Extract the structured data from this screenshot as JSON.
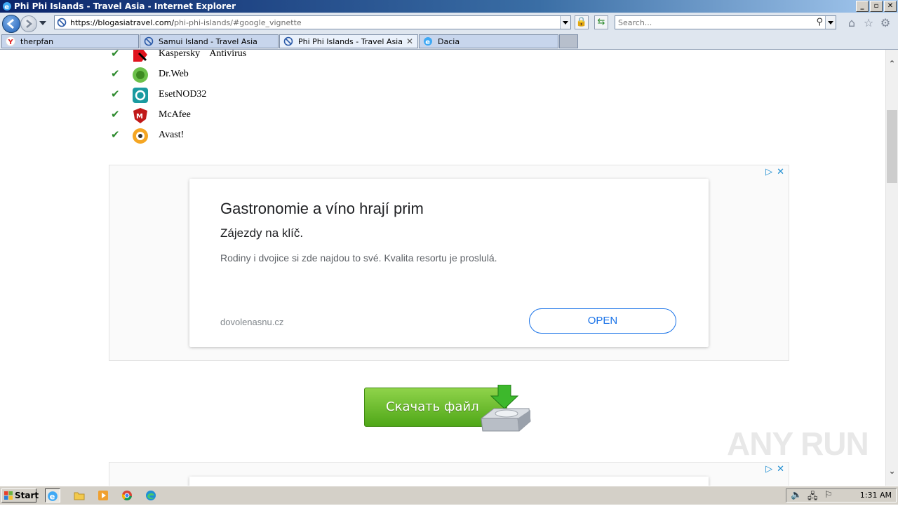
{
  "window": {
    "title": "Phi Phi Islands - Travel Asia - Internet Explorer",
    "buttons": [
      "_",
      "▫",
      "✕"
    ]
  },
  "address": {
    "url_host": "https://blogasiatravel.com/",
    "url_path": "phi-phi-islands/#google_vignette"
  },
  "search": {
    "placeholder": "Search..."
  },
  "tabs": [
    {
      "label": "therpfan",
      "icon": "yandex-icon"
    },
    {
      "label": "Samui Island - Travel Asia",
      "icon": "site-icon"
    },
    {
      "label": "Phi Phi Islands - Travel Asia",
      "icon": "site-icon",
      "active": true,
      "close": "✕"
    },
    {
      "label": "Dacia",
      "icon": "ie-icon"
    }
  ],
  "antivirus": [
    {
      "name": "Kaspersky    Antivirus",
      "logo": "kaspersky-logo"
    },
    {
      "name": "Dr.Web",
      "logo": "drweb-logo"
    },
    {
      "name": "EsetNOD32",
      "logo": "eset-logo"
    },
    {
      "name": "McAfee",
      "logo": "mcafee-logo"
    },
    {
      "name": "Avast!",
      "logo": "avast-logo"
    }
  ],
  "ad": {
    "headline": "Gastronomie a víno hrají prim",
    "subheadline": "Zájezdy na klíč.",
    "description": "Rodiny i dvojice si zde najdou to své. Kvalita resortu je proslulá.",
    "domain": "dovolenasnu.cz",
    "cta": "OPEN",
    "adchoices_play": "▷",
    "adchoices_close": "✕"
  },
  "download": {
    "label": "Скачать файл"
  },
  "watermark": "ANY RUN",
  "taskbar": {
    "start": "Start",
    "clock": "1:31 AM"
  },
  "colors": {
    "accent": "#1a73e8",
    "download_green": "#4fa718",
    "check_green": "#2e8b2e"
  }
}
